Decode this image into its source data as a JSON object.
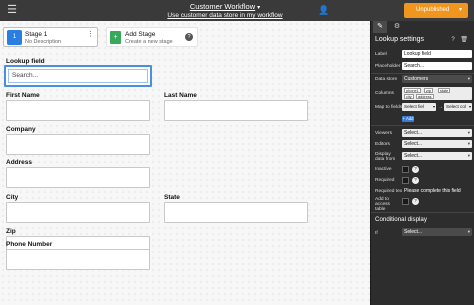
{
  "topbar": {
    "title": "Customer Workflow",
    "title_caret": "▾",
    "subtitle": "Use customer data store in my workflow",
    "publish_label": "Unpublished",
    "publish_chevron": "▾",
    "colors": {
      "background": "#3a3a3a",
      "publish": "#f0961e"
    }
  },
  "stages": {
    "current": {
      "icon_label": "1",
      "name": "Stage 1",
      "description": "No Description",
      "menu": "⋮"
    },
    "add": {
      "icon": "+",
      "name": "Add Stage",
      "description": "Create a new stage",
      "help": "?"
    }
  },
  "form": {
    "fields": [
      {
        "label": "Lookup field",
        "placeholder": "Search..."
      },
      {
        "label": "First Name"
      },
      {
        "label": "Last Name"
      },
      {
        "label": "Company"
      },
      {
        "label": "Address"
      },
      {
        "label": "City"
      },
      {
        "label": "State"
      },
      {
        "label": "Zip"
      },
      {
        "label": "Phone Number"
      }
    ]
  },
  "panel": {
    "heading": "Lookup settings",
    "heading_icons": "? 🗑",
    "rows": {
      "label": {
        "name": "Label",
        "value": "Lookup field"
      },
      "placeholder": {
        "name": "Placeholder",
        "value": "Search..."
      },
      "datastore": {
        "name": "Data store",
        "value": "Customers"
      },
      "columns": {
        "name": "Columns",
        "chips": [
          "phone1",
          "zip",
          "state",
          "city",
          "address"
        ]
      },
      "map": {
        "name": "Map to fields",
        "left": "Select fiel",
        "right": "Select col"
      },
      "add": "+ Add",
      "viewers": {
        "name": "Viewers",
        "value": "Select..."
      },
      "editors": {
        "name": "Editors",
        "value": "Select..."
      },
      "display": {
        "name": "Display data from",
        "value": "Select..."
      },
      "inactive": {
        "name": "Inactive"
      },
      "required": {
        "name": "Required"
      },
      "required_text": {
        "name": "Required text",
        "value": "Please complete this field"
      },
      "add_access": {
        "name": "Add to access table"
      },
      "conditional": "Conditional display",
      "if": {
        "name": "If",
        "value": "Select..."
      }
    }
  }
}
